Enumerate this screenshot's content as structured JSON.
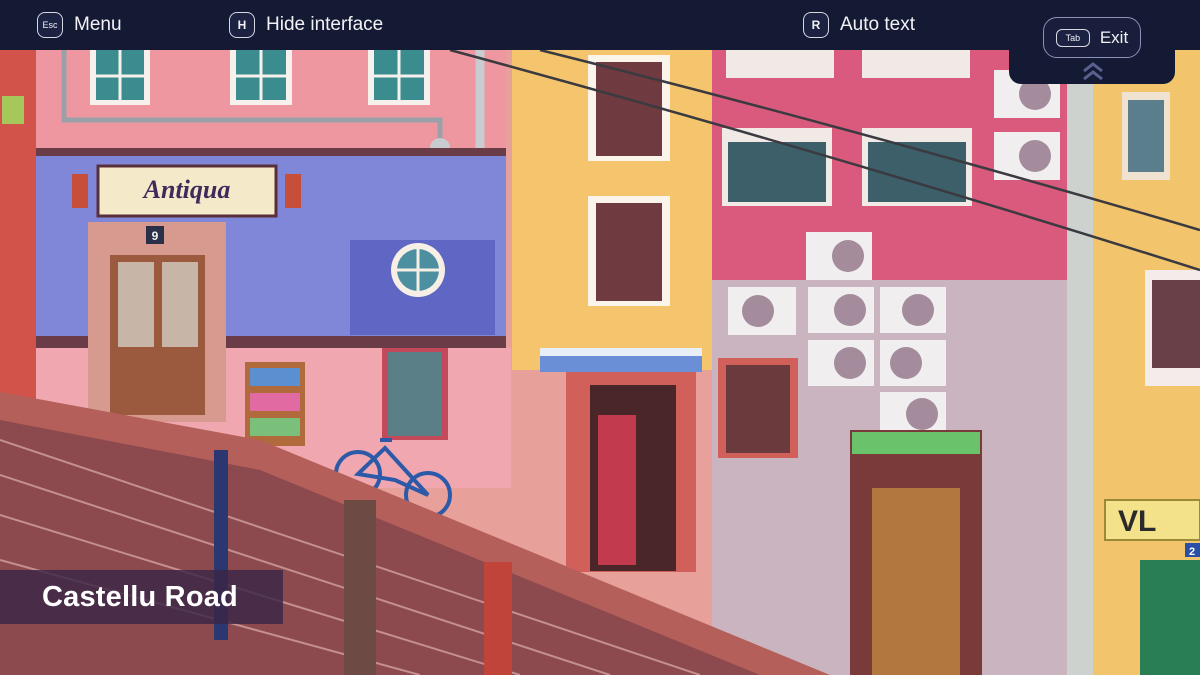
{
  "hud": {
    "menu": {
      "key": "Esc",
      "label": "Menu"
    },
    "hide": {
      "key": "H",
      "label": "Hide interface"
    },
    "auto": {
      "key": "R",
      "label": "Auto text"
    },
    "exit": {
      "key": "Tab",
      "label": "Exit"
    }
  },
  "scene": {
    "shop_sign": "Antiqua",
    "door_number": "9",
    "corner_sign": "VL",
    "edge_number": "2"
  },
  "location": {
    "name": "Castellu Road"
  },
  "colors": {
    "bar": "#141a33",
    "caption_bg": "#3a2646",
    "pink_facade": "#e98c99",
    "blue_facade": "#7f86d6",
    "yellow_facade": "#f2c46b",
    "magenta_facade": "#d9577a"
  }
}
